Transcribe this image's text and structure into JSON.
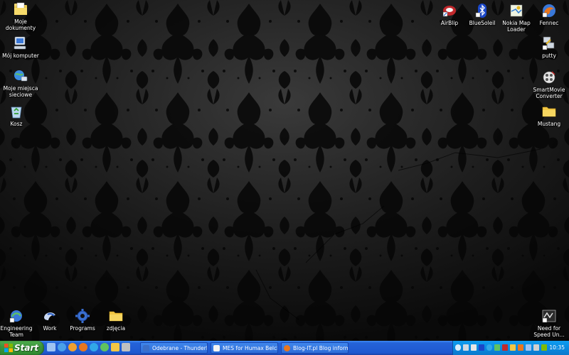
{
  "desktop": {
    "left_icons": [
      {
        "label": "Moje dokumenty",
        "icon": "my-documents-icon"
      },
      {
        "label": "Mój komputer",
        "icon": "my-computer-icon"
      },
      {
        "label": "Moje miejsca sieciowe",
        "icon": "network-places-icon"
      },
      {
        "label": "Kosz",
        "icon": "recycle-bin-icon"
      }
    ],
    "right_top_icons": [
      {
        "label": "AirBlip",
        "icon": "airblip-icon"
      },
      {
        "label": "BlueSoleil",
        "icon": "bluetooth-icon"
      },
      {
        "label": "Nokia Map Loader",
        "icon": "nokia-map-loader-icon"
      },
      {
        "label": "Fennec",
        "icon": "fennec-icon"
      }
    ],
    "right_column_icons": [
      {
        "label": "putty",
        "icon": "putty-icon"
      },
      {
        "label": "SmartMovie Converter",
        "icon": "smartmovie-icon"
      },
      {
        "label": "Mustang",
        "icon": "folder-icon"
      }
    ],
    "bottom_icons": [
      {
        "label": "Engineering Team",
        "icon": "engineering-team-icon"
      },
      {
        "label": "Work",
        "icon": "work-icon"
      },
      {
        "label": "Programs",
        "icon": "programs-gear-icon"
      },
      {
        "label": "zdjęcia",
        "icon": "folder-icon"
      }
    ],
    "bottom_right_icon": {
      "label": "Need for Speed Un...",
      "icon": "nfs-icon"
    }
  },
  "taskbar": {
    "start_label": "Start",
    "quick_launch": [
      "show-desktop-icon",
      "ie-icon",
      "media-player-icon",
      "firefox-icon",
      "skype-icon",
      "messenger-icon",
      "explorer-icon",
      "winamp-icon"
    ],
    "tasks": [
      {
        "label": "Odebrane - Thunderbird",
        "icon": "thunderbird-icon"
      },
      {
        "label": "MES for Humax Belch...",
        "icon": "document-icon"
      },
      {
        "label": "Blog-IT.pl Blog inform...",
        "icon": "firefox-icon"
      }
    ],
    "clock": "10:35"
  },
  "colors": {
    "taskbar_blue": "#245edb",
    "start_green": "#3c963c",
    "tray_blue": "#0b8ae0"
  }
}
